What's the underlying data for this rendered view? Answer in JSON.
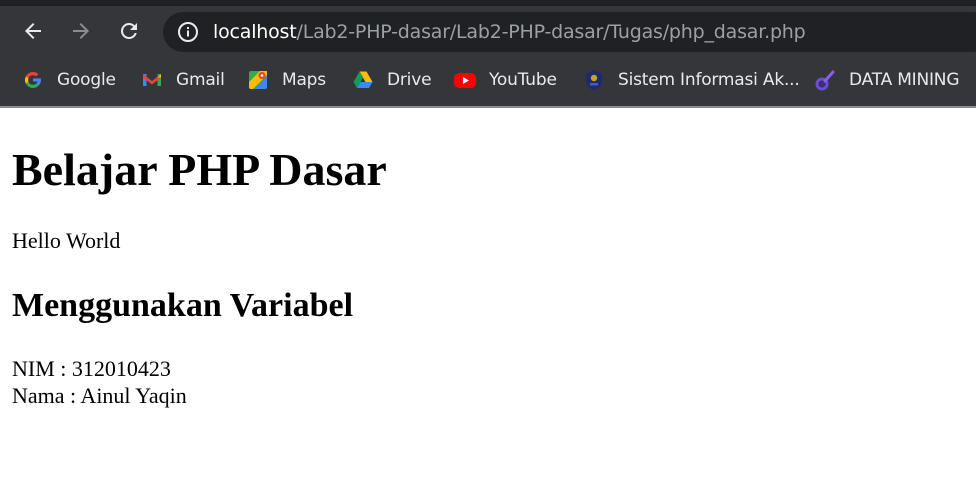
{
  "browser": {
    "url_host": "localhost",
    "url_path": "/Lab2-PHP-dasar/Lab2-PHP-dasar/Tugas/php_dasar.php",
    "toolbar": {
      "back_icon": "arrow-left-icon",
      "forward_icon": "arrow-right-icon",
      "reload_icon": "reload-icon",
      "site_info_icon": "info-circle-icon"
    },
    "bookmarks": [
      {
        "label": "Google",
        "icon": "google-icon"
      },
      {
        "label": "Gmail",
        "icon": "gmail-icon"
      },
      {
        "label": "Maps",
        "icon": "maps-icon"
      },
      {
        "label": "Drive",
        "icon": "drive-icon"
      },
      {
        "label": "YouTube",
        "icon": "youtube-icon"
      },
      {
        "label": "Sistem Informasi Ak...",
        "icon": "university-emblem-icon"
      },
      {
        "label": "DATA MINING",
        "icon": "data-mining-icon"
      }
    ],
    "colors": {
      "toolbar_bg": "#35363a",
      "omnibox_bg": "#202124",
      "host_text": "#ffffff",
      "path_text": "#9aa0a6"
    }
  },
  "page": {
    "heading": "Belajar PHP Dasar",
    "hello": "Hello World",
    "subheading": "Menggunakan Variabel",
    "nim_line": "NIM : 312010423",
    "nama_line": "Nama : Ainul Yaqin"
  }
}
